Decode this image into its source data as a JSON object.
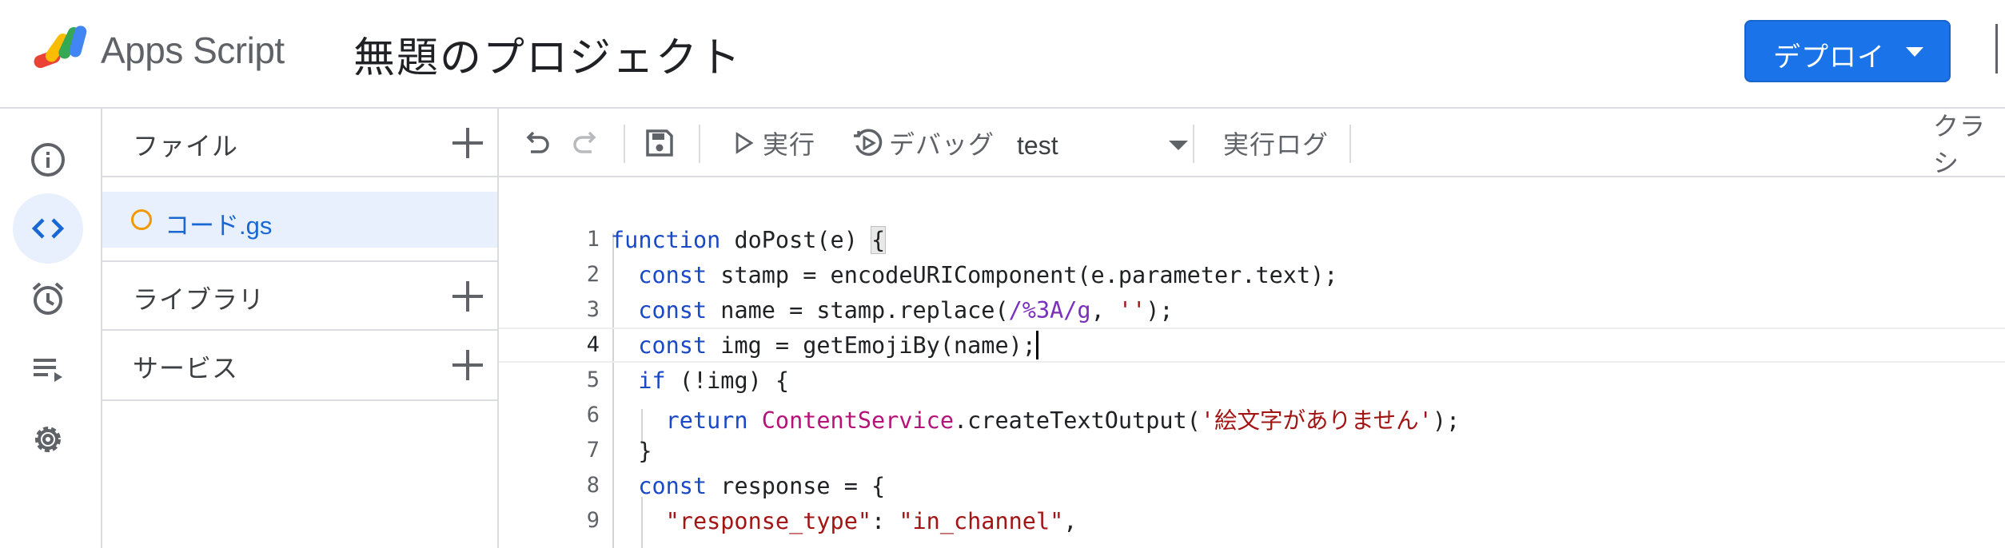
{
  "header": {
    "app_name": "Apps Script",
    "project_title": "無題のプロジェクト",
    "deploy_label": "デプロイ"
  },
  "rail": {
    "items": [
      {
        "name": "overview",
        "icon": "info-icon"
      },
      {
        "name": "editor",
        "icon": "code-icon",
        "active": true
      },
      {
        "name": "triggers",
        "icon": "alarm-clock-icon"
      },
      {
        "name": "executions",
        "icon": "executions-list-icon"
      },
      {
        "name": "settings",
        "icon": "gear-icon"
      }
    ]
  },
  "files_panel": {
    "files_label": "ファイル",
    "file_name": "コード.gs",
    "libraries_label": "ライブラリ",
    "services_label": "サービス"
  },
  "toolbar": {
    "run_label": "実行",
    "debug_label": "デバッグ",
    "function_selected": "test",
    "log_label": "実行ログ",
    "classic_label": "クラシ"
  },
  "editor": {
    "current_line": 4,
    "lines": [
      {
        "num": "1",
        "text": "function doPost(e) {"
      },
      {
        "num": "2",
        "text": "  const stamp = encodeURIComponent(e.parameter.text);"
      },
      {
        "num": "3",
        "text": "  const name = stamp.replace(/%3A/g, '');"
      },
      {
        "num": "4",
        "text": "  const img = getEmojiBy(name);"
      },
      {
        "num": "5",
        "text": "  if (!img) {"
      },
      {
        "num": "6",
        "text": "    return ContentService.createTextOutput('絵文字がありません');"
      },
      {
        "num": "7",
        "text": "  }"
      },
      {
        "num": "8",
        "text": "  const response = {"
      },
      {
        "num": "9",
        "text": "    \"response_type\": \"in_channel\","
      }
    ]
  },
  "colors": {
    "accent": "#1a73e8",
    "keyword": "#1a49c8",
    "string": "#a31515",
    "regex": "#7a2fbd",
    "type": "#b5137a",
    "file_dot": "#f29900"
  }
}
